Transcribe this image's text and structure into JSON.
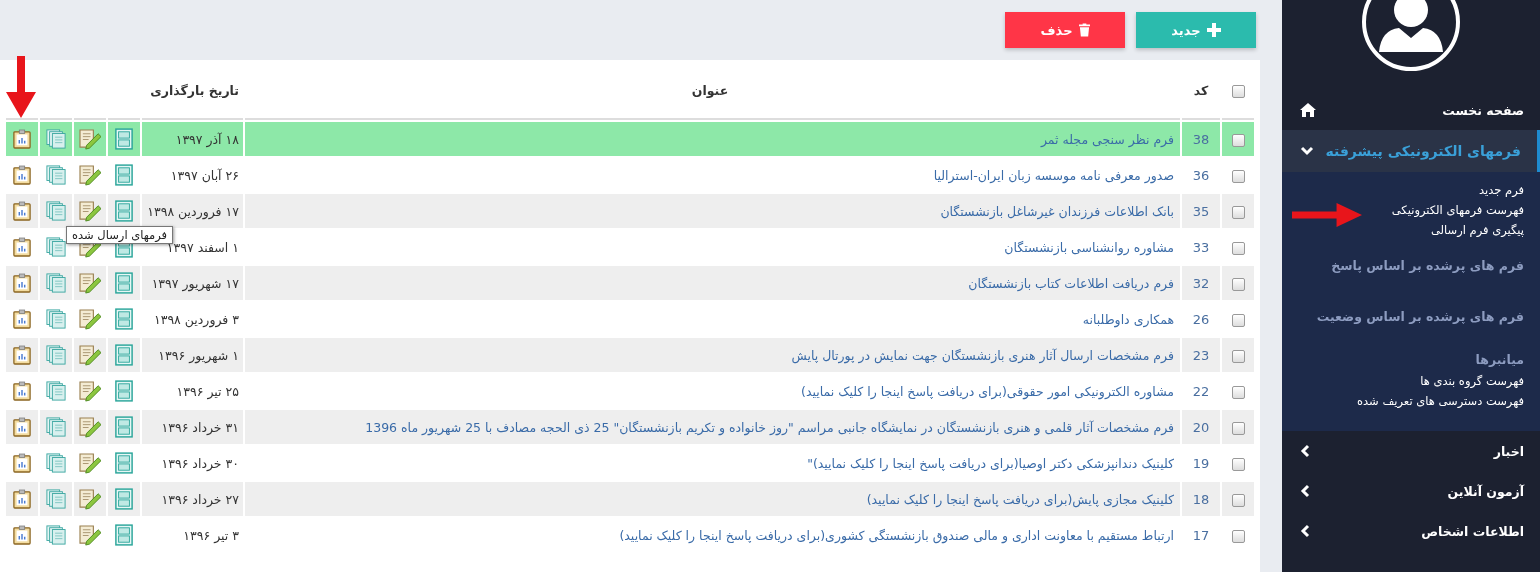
{
  "toolbar": {
    "buttons": [
      {
        "kind": "add",
        "label": "جدید"
      },
      {
        "kind": "delete",
        "label": "حذف"
      }
    ]
  },
  "table": {
    "header_checked": false,
    "columns": [
      "کد",
      "عنوان",
      "تاریخ بارگذاری"
    ],
    "rows": [
      {
        "checked": false,
        "selected": true,
        "code": "38",
        "title": "فرم نظر سنجی مجله ثمر",
        "date": "۱۸ آذر ۱۳۹۷"
      },
      {
        "checked": false,
        "selected": false,
        "code": "36",
        "title": "صدور معرفی نامه موسسه زبان ایران-استرالیا",
        "date": "۲۶ آبان ۱۳۹۷"
      },
      {
        "checked": false,
        "selected": false,
        "code": "35",
        "title": "بانک اطلاعات فرزندان غیرشاغل بازنشستگان",
        "date": "۱۷ فروردین ۱۳۹۸"
      },
      {
        "checked": false,
        "selected": false,
        "code": "33",
        "title": "مشاوره روانشناسی بازنشستگان",
        "date": "۱ اسفند ۱۳۹۷"
      },
      {
        "checked": false,
        "selected": false,
        "code": "32",
        "title": "فرم دریافت اطلاعات کتاب بازنشستگان",
        "date": "۱۷ شهریور ۱۳۹۷"
      },
      {
        "checked": false,
        "selected": false,
        "code": "26",
        "title": "همکاری داوطلبانه",
        "date": "۳ فروردین ۱۳۹۸"
      },
      {
        "checked": false,
        "selected": false,
        "code": "23",
        "title": "فرم مشخصات ارسال آثار هنری بازنشستگان جهت نمایش در پورتال پایش",
        "date": "۱ شهریور ۱۳۹۶"
      },
      {
        "checked": false,
        "selected": false,
        "code": "22",
        "title": "مشاوره الکترونیکی امور حقوقی(برای دریافت پاسخ اینجا را کلیک نمایید)",
        "date": "۲۵ تیر ۱۳۹۶"
      },
      {
        "checked": false,
        "selected": false,
        "code": "20",
        "title": "فرم مشخصات آثار قلمی و هنری بازنشستگان در نمایشگاه جانبی مراسم \"روز خانواده و تکریم بازنشستگان\" 25 ذی الحجه مصادف با 25 شهریور ماه 1396",
        "date": "۳۱ خرداد ۱۳۹۶"
      },
      {
        "checked": false,
        "selected": false,
        "code": "19",
        "title": "کلینیک دندانپزشکی دکتر اوصیا(برای دریافت پاسخ اینجا را کلیک نمایید)\"",
        "date": "۳۰ خرداد ۱۳۹۶"
      },
      {
        "checked": false,
        "selected": false,
        "code": "18",
        "title": "کلینیک مجازی پایش(برای دریافت پاسخ اینجا را کلیک نمایید)",
        "date": "۲۷ خرداد ۱۳۹۶"
      },
      {
        "checked": false,
        "selected": false,
        "code": "17",
        "title": "ارتباط مستقیم با معاونت اداری و مالی صندوق بازنشستگی کشوری(برای دریافت پاسخ اینجا را کلیک نمایید)",
        "date": "۳ تیر ۱۳۹۶"
      }
    ],
    "tooltip": {
      "text": "فرمهای ارسال شده"
    }
  },
  "sidebar": {
    "items": [
      {
        "kind": "home",
        "label": "صفحه نخست"
      },
      {
        "kind": "group",
        "label": "فرمهای الکترونیکی پیشرفته",
        "expanded": true,
        "children": [
          {
            "kind": "link",
            "label": "فرم جدید"
          },
          {
            "kind": "link",
            "label": "فهرست فرمهای الکترونیکی"
          },
          {
            "kind": "link",
            "label": "پیگیری فرم ارسالی"
          },
          {
            "kind": "section",
            "label": "فرم های پرشده بر اساس پاسخ"
          },
          {
            "kind": "section",
            "label": "فرم های پرشده بر اساس وضعیت"
          },
          {
            "kind": "heading",
            "label": "میانبرها"
          },
          {
            "kind": "link",
            "label": "فهرست گروه بندی ها"
          },
          {
            "kind": "link",
            "label": "فهرست دسترسی های تعریف شده"
          }
        ]
      },
      {
        "kind": "group",
        "label": "اخبار",
        "expanded": false
      },
      {
        "kind": "group",
        "label": "آزمون آنلاین",
        "expanded": false
      },
      {
        "kind": "group",
        "label": "اطلاعات اشخاص",
        "expanded": false
      }
    ]
  }
}
